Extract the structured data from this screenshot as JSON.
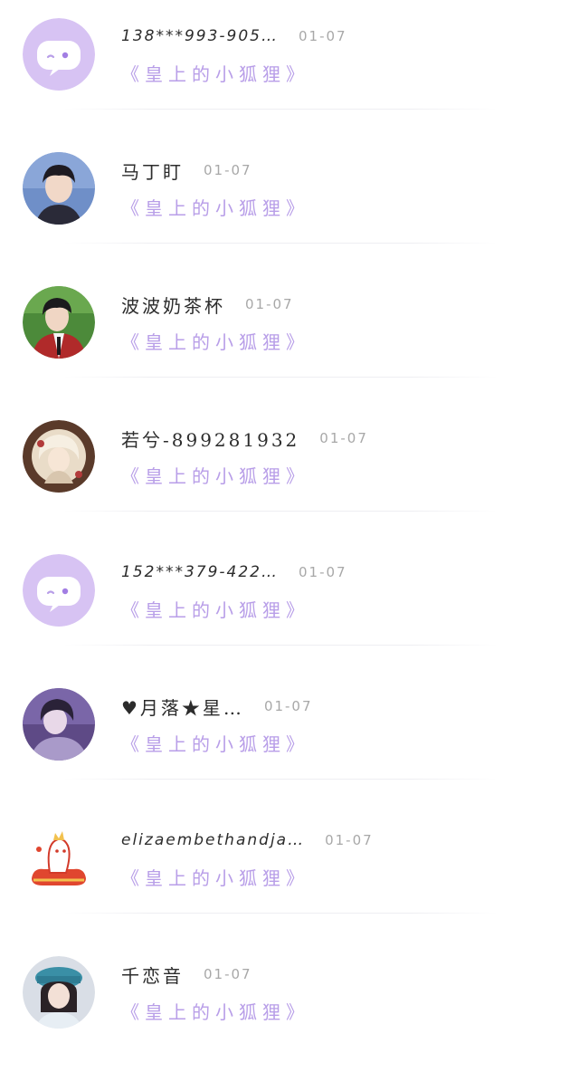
{
  "chats": [
    {
      "name": "138***993-905…",
      "date": "01-07",
      "preview": "《皇上的小狐狸》",
      "avatar": "default-chat-icon"
    },
    {
      "name": "马丁盯",
      "date": "01-07",
      "preview": "《皇上的小狐狸》",
      "avatar": "photo-avatar"
    },
    {
      "name": "波波奶茶杯",
      "date": "01-07",
      "preview": "《皇上的小狐狸》",
      "avatar": "photo-avatar"
    },
    {
      "name": "若兮-899281932",
      "date": "01-07",
      "preview": "《皇上的小狐狸》",
      "avatar": "illustration-avatar"
    },
    {
      "name": "152***379-422…",
      "date": "01-07",
      "preview": "《皇上的小狐狸》",
      "avatar": "default-chat-icon"
    },
    {
      "name": "♥月落★星…",
      "date": "01-07",
      "preview": "《皇上的小狐狸》",
      "avatar": "photo-avatar"
    },
    {
      "name": "elizaembethandja…",
      "date": "01-07",
      "preview": "《皇上的小狐狸》",
      "avatar": "cartoon-avatar"
    },
    {
      "name": "千恋音",
      "date": "01-07",
      "preview": "《皇上的小狐狸》",
      "avatar": "photo-avatar"
    }
  ],
  "colors": {
    "accent_purple": "#b89ee8",
    "default_avatar_bg": "#d7c3f3",
    "name_text": "#2c2c2c",
    "date_text": "#a8a8a8"
  }
}
